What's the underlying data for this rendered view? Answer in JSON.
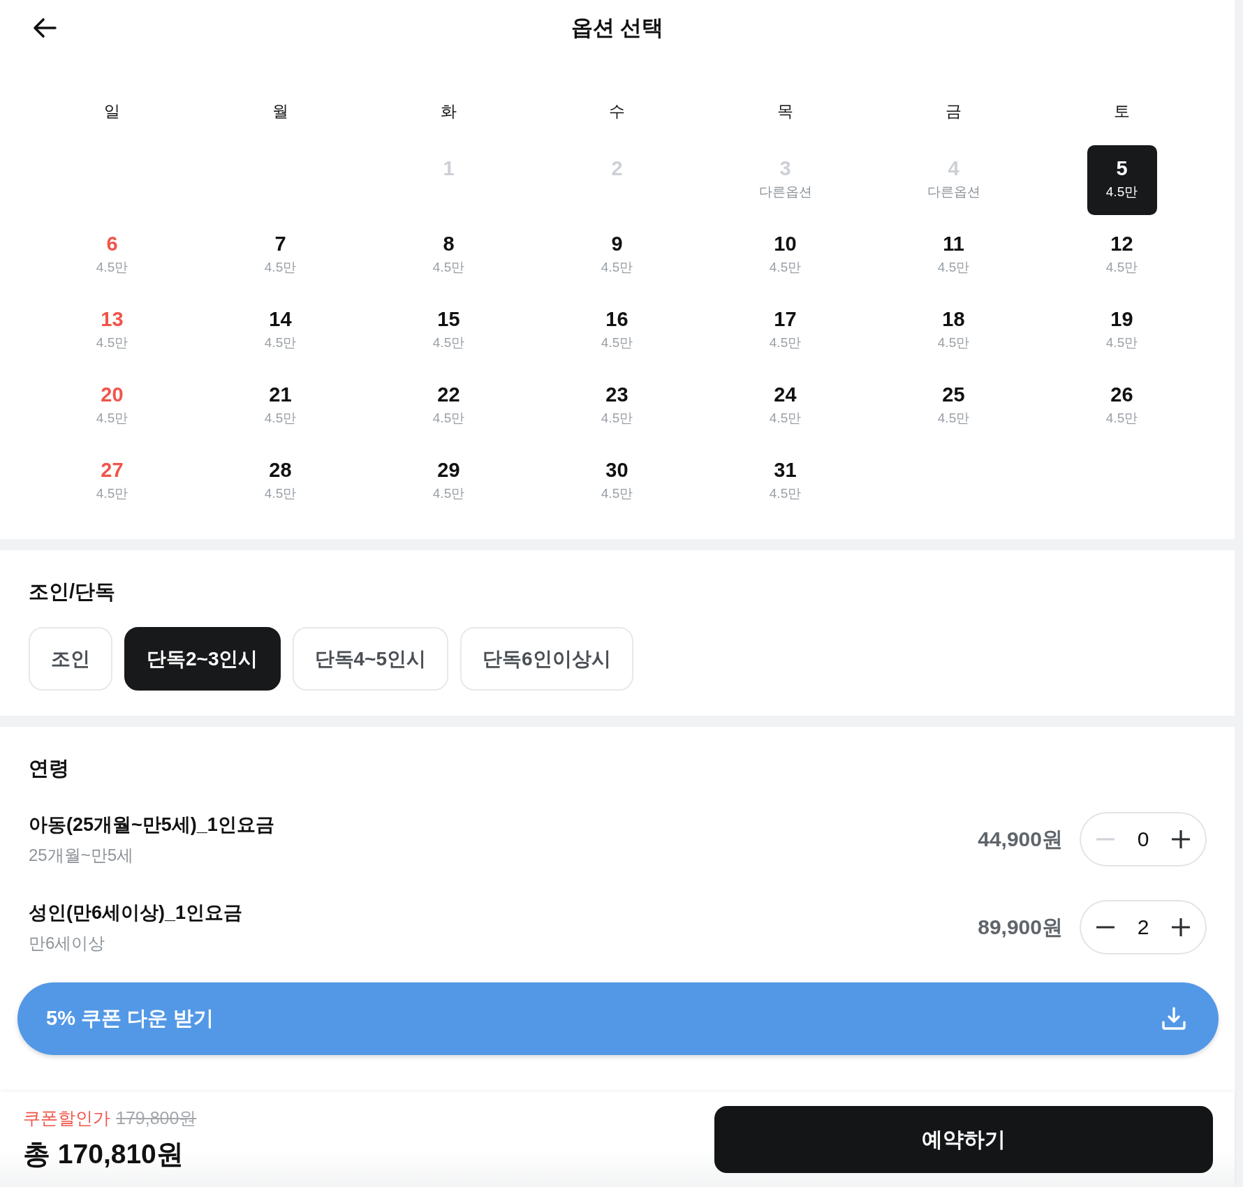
{
  "header": {
    "title": "옵션 선택"
  },
  "calendar": {
    "weekdays": [
      "일",
      "월",
      "화",
      "수",
      "목",
      "금",
      "토"
    ],
    "weeks": [
      [
        {
          "kind": "blank"
        },
        {
          "kind": "blank"
        },
        {
          "kind": "day",
          "day": "1",
          "disabled": true,
          "selected": false
        },
        {
          "kind": "day",
          "day": "2",
          "disabled": true,
          "selected": false
        },
        {
          "kind": "day",
          "day": "3",
          "note": "다른옵션",
          "disabled": true,
          "selected": false
        },
        {
          "kind": "day",
          "day": "4",
          "note": "다른옵션",
          "disabled": true,
          "selected": false
        },
        {
          "kind": "day",
          "day": "5",
          "note": "4.5만",
          "disabled": false,
          "selected": true
        }
      ],
      [
        {
          "kind": "day",
          "day": "6",
          "note": "4.5만",
          "disabled": false,
          "selected": false
        },
        {
          "kind": "day",
          "day": "7",
          "note": "4.5만",
          "disabled": false,
          "selected": false
        },
        {
          "kind": "day",
          "day": "8",
          "note": "4.5만",
          "disabled": false,
          "selected": false
        },
        {
          "kind": "day",
          "day": "9",
          "note": "4.5만",
          "disabled": false,
          "selected": false
        },
        {
          "kind": "day",
          "day": "10",
          "note": "4.5만",
          "disabled": false,
          "selected": false
        },
        {
          "kind": "day",
          "day": "11",
          "note": "4.5만",
          "disabled": false,
          "selected": false
        },
        {
          "kind": "day",
          "day": "12",
          "note": "4.5만",
          "disabled": false,
          "selected": false
        }
      ],
      [
        {
          "kind": "day",
          "day": "13",
          "note": "4.5만",
          "disabled": false,
          "selected": false
        },
        {
          "kind": "day",
          "day": "14",
          "note": "4.5만",
          "disabled": false,
          "selected": false
        },
        {
          "kind": "day",
          "day": "15",
          "note": "4.5만",
          "disabled": false,
          "selected": false
        },
        {
          "kind": "day",
          "day": "16",
          "note": "4.5만",
          "disabled": false,
          "selected": false
        },
        {
          "kind": "day",
          "day": "17",
          "note": "4.5만",
          "disabled": false,
          "selected": false
        },
        {
          "kind": "day",
          "day": "18",
          "note": "4.5만",
          "disabled": false,
          "selected": false
        },
        {
          "kind": "day",
          "day": "19",
          "note": "4.5만",
          "disabled": false,
          "selected": false
        }
      ],
      [
        {
          "kind": "day",
          "day": "20",
          "note": "4.5만",
          "disabled": false,
          "selected": false
        },
        {
          "kind": "day",
          "day": "21",
          "note": "4.5만",
          "disabled": false,
          "selected": false
        },
        {
          "kind": "day",
          "day": "22",
          "note": "4.5만",
          "disabled": false,
          "selected": false
        },
        {
          "kind": "day",
          "day": "23",
          "note": "4.5만",
          "disabled": false,
          "selected": false
        },
        {
          "kind": "day",
          "day": "24",
          "note": "4.5만",
          "disabled": false,
          "selected": false
        },
        {
          "kind": "day",
          "day": "25",
          "note": "4.5만",
          "disabled": false,
          "selected": false
        },
        {
          "kind": "day",
          "day": "26",
          "note": "4.5만",
          "disabled": false,
          "selected": false
        }
      ],
      [
        {
          "kind": "day",
          "day": "27",
          "note": "4.5만",
          "disabled": false,
          "selected": false
        },
        {
          "kind": "day",
          "day": "28",
          "note": "4.5만",
          "disabled": false,
          "selected": false
        },
        {
          "kind": "day",
          "day": "29",
          "note": "4.5만",
          "disabled": false,
          "selected": false
        },
        {
          "kind": "day",
          "day": "30",
          "note": "4.5만",
          "disabled": false,
          "selected": false
        },
        {
          "kind": "day",
          "day": "31",
          "note": "4.5만",
          "disabled": false,
          "selected": false
        }
      ]
    ]
  },
  "join_type": {
    "title": "조인/단독",
    "options": [
      {
        "label": "조인",
        "selected": false
      },
      {
        "label": "단독2~3인시",
        "selected": true
      },
      {
        "label": "단독4~5인시",
        "selected": false
      },
      {
        "label": "단독6인이상시",
        "selected": false
      }
    ]
  },
  "age": {
    "title": "연령",
    "items": [
      {
        "name": "아동(25개월~만5세)_1인요금",
        "range": "25개월~만5세",
        "price": "44,900원",
        "count": "0",
        "minus_disabled": true
      },
      {
        "name": "성인(만6세이상)_1인요금",
        "range": "만6세이상",
        "price": "89,900원",
        "count": "2",
        "minus_disabled": false
      }
    ]
  },
  "coupon_button": {
    "label": "5% 쿠폰 다운 받기"
  },
  "footer": {
    "discount_label": "쿠폰할인가",
    "original_price": "179,800원",
    "total": "총 170,810원",
    "reserve_button": "예약하기"
  }
}
